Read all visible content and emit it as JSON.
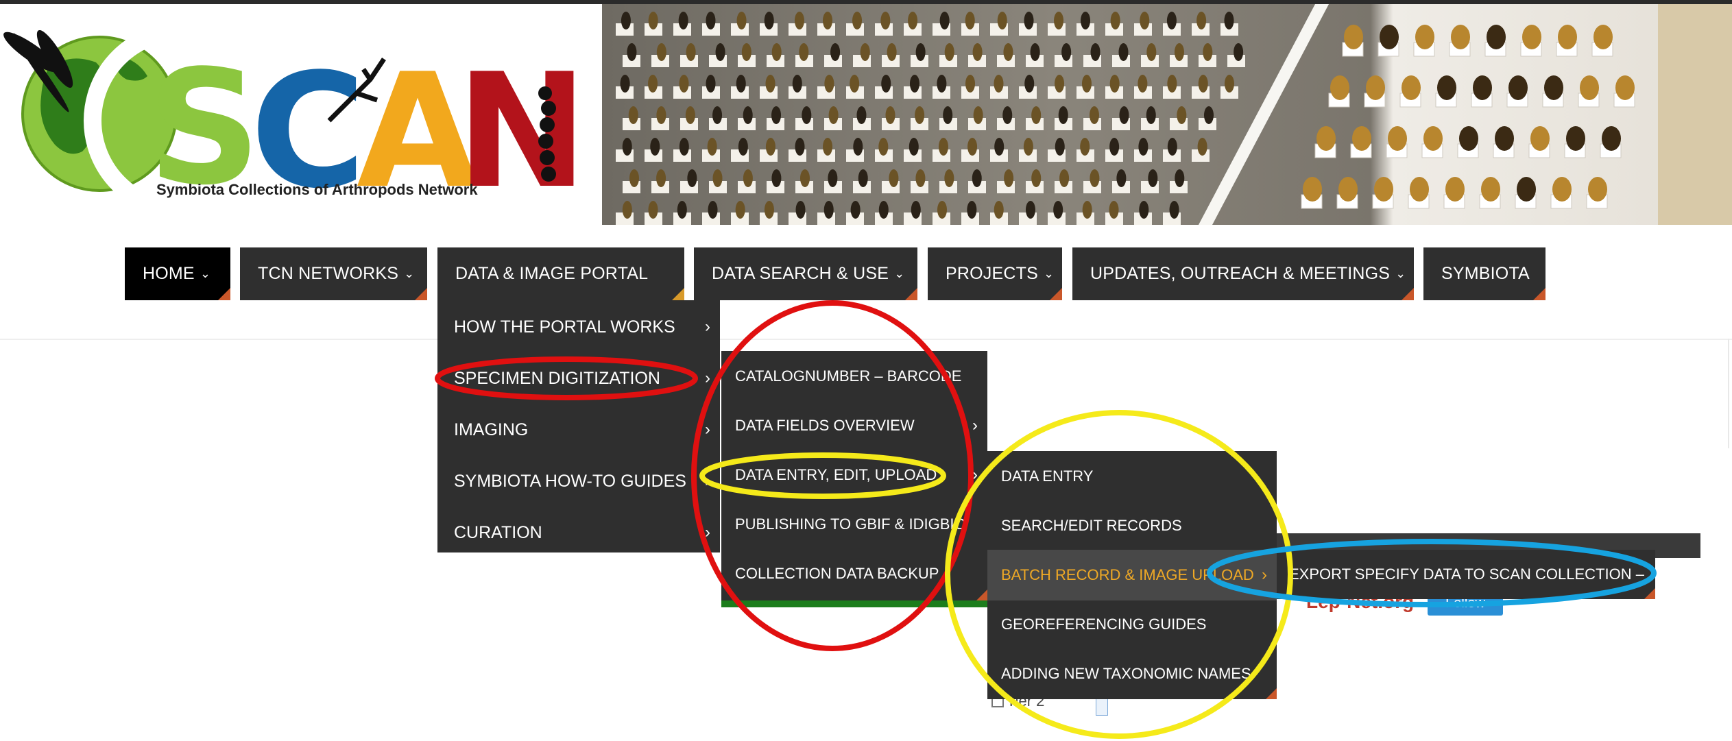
{
  "site": {
    "logo_letters": "SCAN",
    "logo_tagline": "Symbiota Collections of Arthropods Network"
  },
  "nav": {
    "items": [
      {
        "label": "HOME",
        "chevron": true
      },
      {
        "label": "TCN NETWORKS",
        "chevron": true
      },
      {
        "label": "DATA & IMAGE PORTAL",
        "chevron": false
      },
      {
        "label": "DATA SEARCH & USE",
        "chevron": true
      },
      {
        "label": "PROJECTS",
        "chevron": true
      },
      {
        "label": "UPDATES, OUTREACH & MEETINGS",
        "chevron": true
      },
      {
        "label": "SYMBIOTA",
        "chevron": false
      }
    ]
  },
  "menu_level1": {
    "items": [
      {
        "label": "HOW THE PORTAL WORKS"
      },
      {
        "label": "SPECIMEN DIGITIZATION"
      },
      {
        "label": "IMAGING"
      },
      {
        "label": "SYMBIOTA HOW-TO GUIDES"
      },
      {
        "label": "CURATION"
      }
    ]
  },
  "menu_level2": {
    "items": [
      {
        "label": "CATALOGNUMBER – BARCODE"
      },
      {
        "label": "DATA FIELDS OVERVIEW"
      },
      {
        "label": "DATA ENTRY, EDIT, UPLOAD"
      },
      {
        "label": "PUBLISHING TO GBIF & IDIGBIO"
      },
      {
        "label": "COLLECTION DATA BACKUP"
      }
    ]
  },
  "menu_level3": {
    "items": [
      {
        "label": "DATA ENTRY"
      },
      {
        "label": "SEARCH/EDIT RECORDS"
      },
      {
        "label": "BATCH RECORD & IMAGE UPLOAD"
      },
      {
        "label": "GEOREFERENCING GUIDES"
      },
      {
        "label": "ADDING NEW TAXONOMIC NAMES"
      }
    ]
  },
  "menu_level4": {
    "items": [
      {
        "label": "EXPORT SPECIFY DATA TO SCAN COLLECTION –"
      }
    ]
  },
  "background": {
    "lepnet_text": "Lep-Net.org",
    "follow_label": "Follow",
    "tier_label": "Tier 2"
  },
  "colors": {
    "nav_bg": "#2f2f2f",
    "nav_active_bg": "#000000",
    "highlight_text": "#f0a925",
    "annot_red": "#e01010",
    "annot_yellow": "#f5ea1a",
    "annot_blue": "#16a3e0",
    "logo_green": "#8cc63f",
    "logo_blue": "#1565a8",
    "logo_gold": "#f2a81d",
    "logo_red": "#b3131b"
  }
}
